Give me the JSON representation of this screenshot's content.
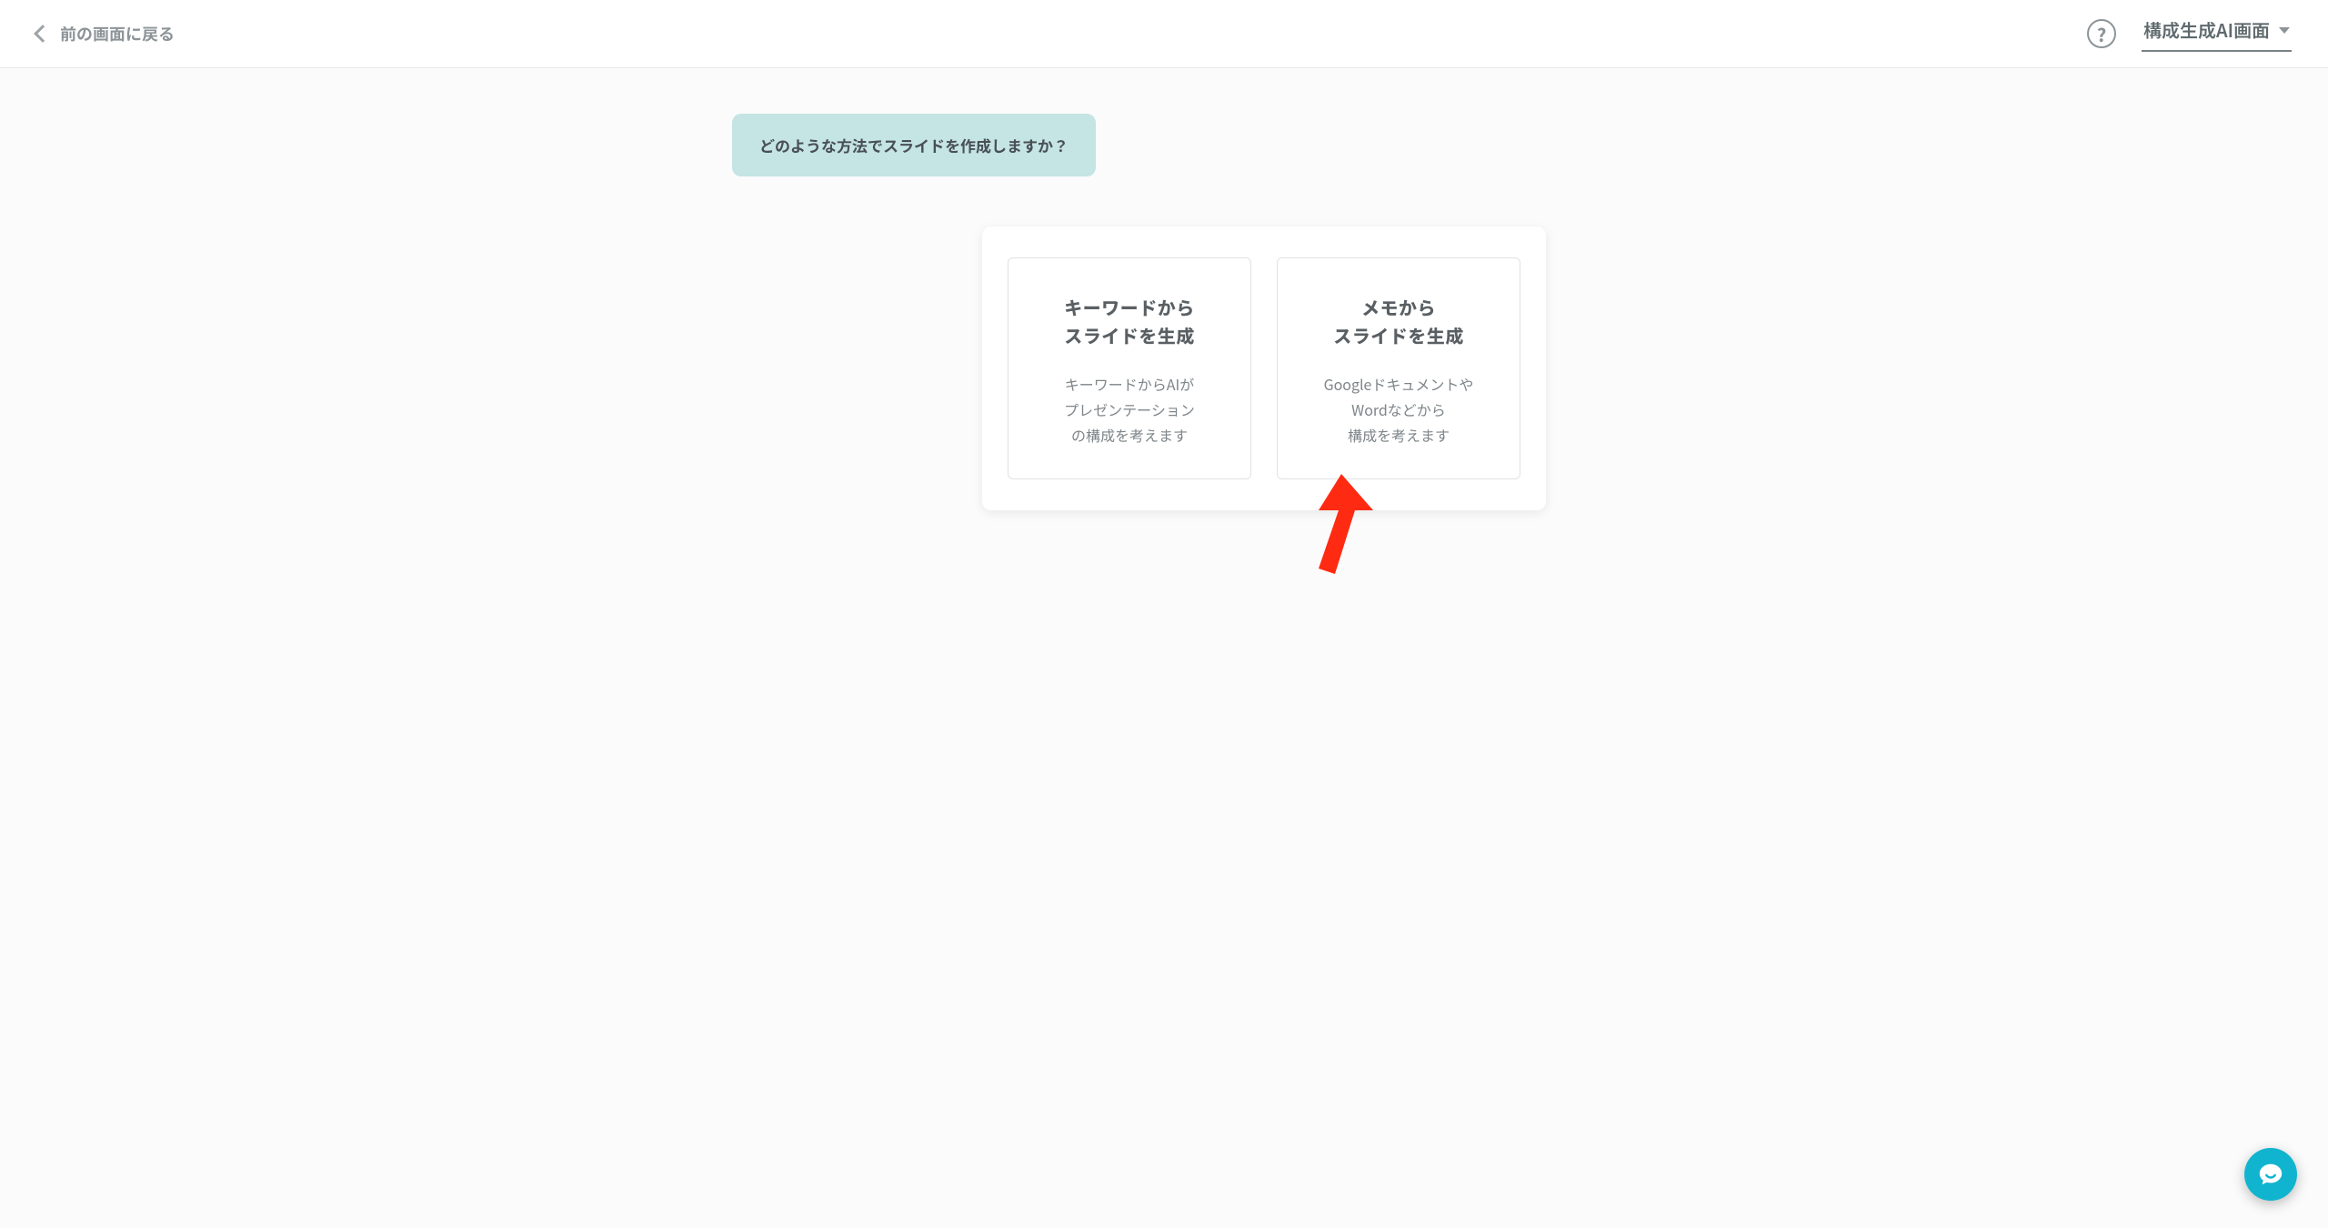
{
  "header": {
    "back_label": "前の画面に戻る",
    "mode_label": "構成生成AI画面"
  },
  "prompt": "どのような方法でスライドを作成しますか？",
  "options": [
    {
      "title_line1": "キーワードから",
      "title_line2": "スライドを生成",
      "desc_line1": "キーワードからAIが",
      "desc_line2": "プレゼンテーション",
      "desc_line3": "の構成を考えます"
    },
    {
      "title_line1": "メモから",
      "title_line2": "スライドを生成",
      "desc_line1": "Googleドキュメントや",
      "desc_line2": "Wordなどから",
      "desc_line3": "構成を考えます"
    }
  ]
}
